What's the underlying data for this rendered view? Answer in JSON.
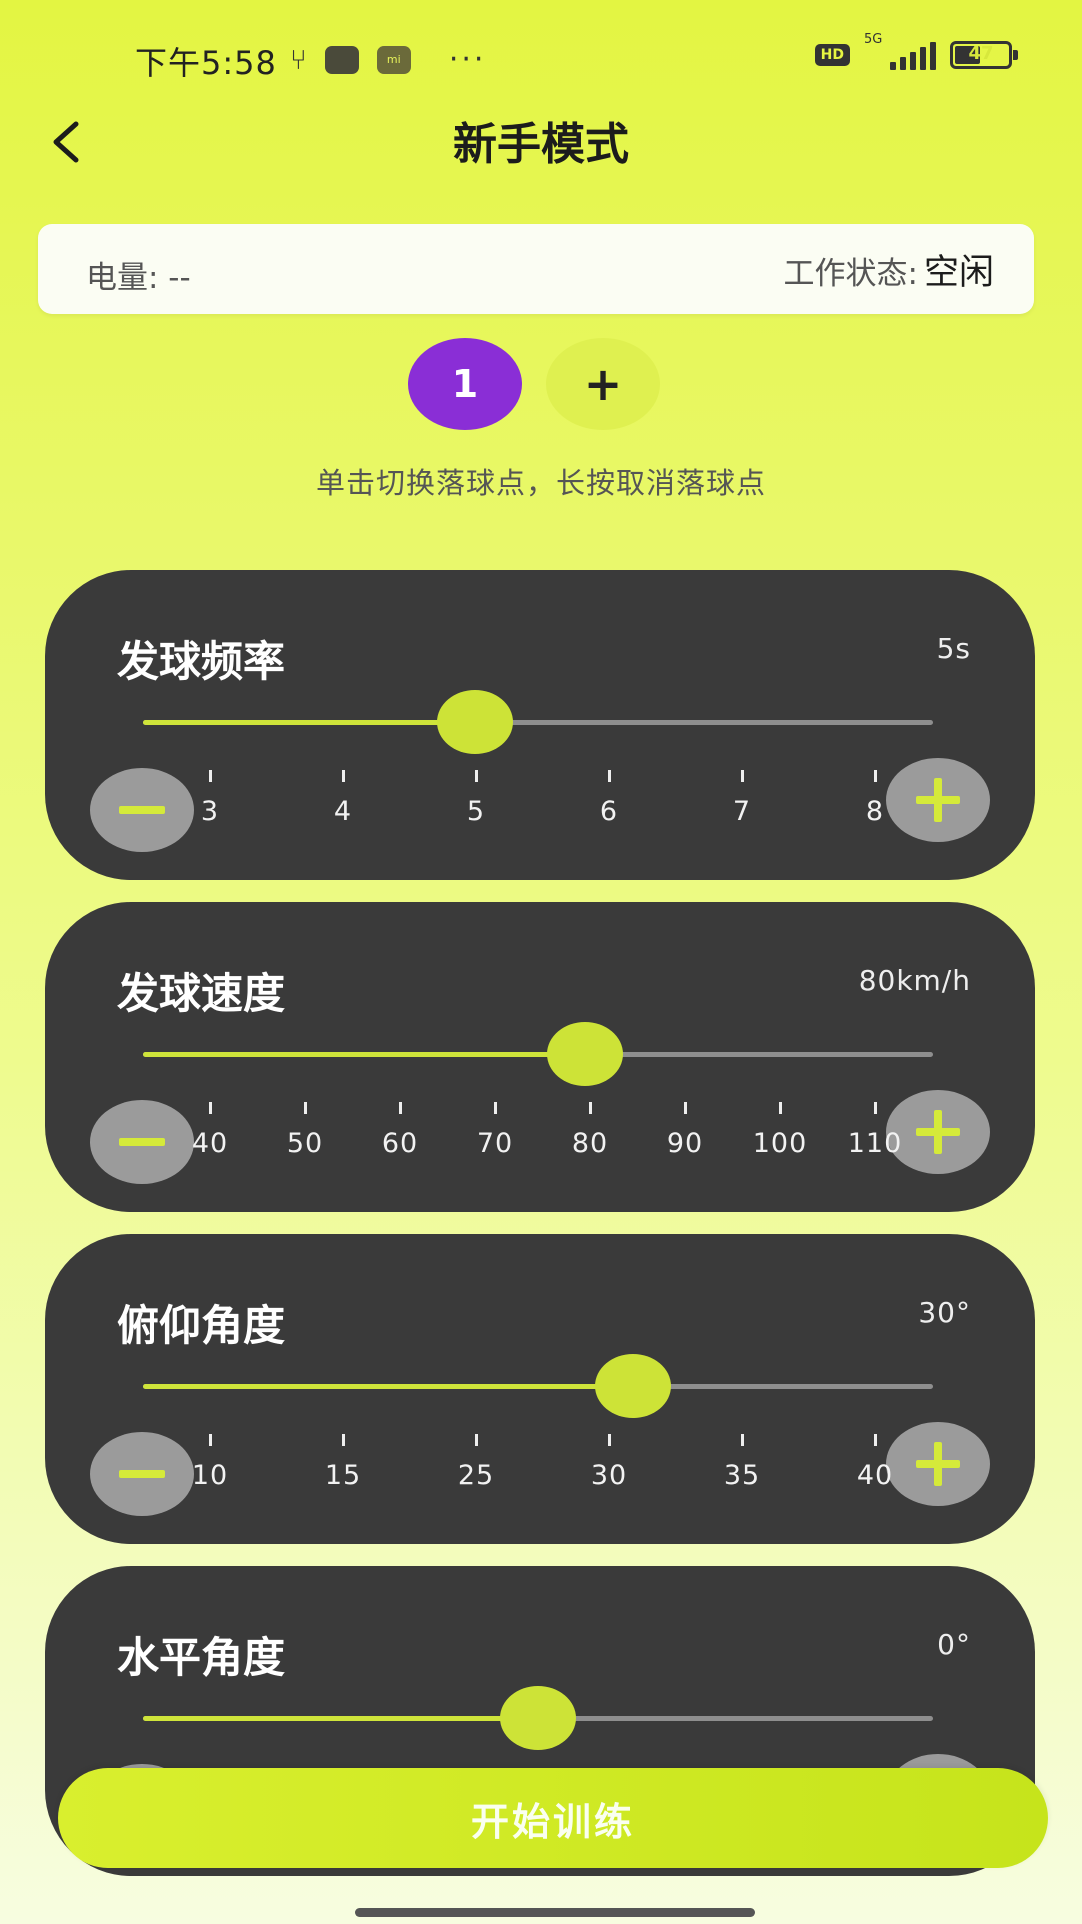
{
  "status_bar": {
    "time": "下午5:58",
    "more": "···",
    "hd_label": "HD",
    "network": "5G",
    "battery_level": "47"
  },
  "header": {
    "title": "新手模式"
  },
  "info_bar": {
    "battery_label": "电量: --",
    "status_label": "工作状态:",
    "status_value": "空闲"
  },
  "points": {
    "active": "1",
    "add": "+",
    "hint": "单击切换落球点，长按取消落球点"
  },
  "sliders": [
    {
      "title": "发球频率",
      "value_text": "5s",
      "ticks": [
        "3",
        "4",
        "5",
        "6",
        "7",
        "8"
      ],
      "fraction": 0.42
    },
    {
      "title": "发球速度",
      "value_text": "80km/h",
      "ticks": [
        "40",
        "50",
        "60",
        "70",
        "80",
        "90",
        "100",
        "110"
      ],
      "fraction": 0.56
    },
    {
      "title": "俯仰角度",
      "value_text": "30°",
      "ticks": [
        "10",
        "15",
        "25",
        "30",
        "35",
        "40"
      ],
      "fraction": 0.62
    },
    {
      "title": "水平角度",
      "value_text": "0°",
      "ticks": [],
      "fraction": 0.5
    }
  ],
  "start_button": {
    "label": "开始训练"
  },
  "colors": {
    "accent": "#cde337",
    "point_active": "#8a2ed6",
    "card_bg": "#3a3a3a"
  }
}
